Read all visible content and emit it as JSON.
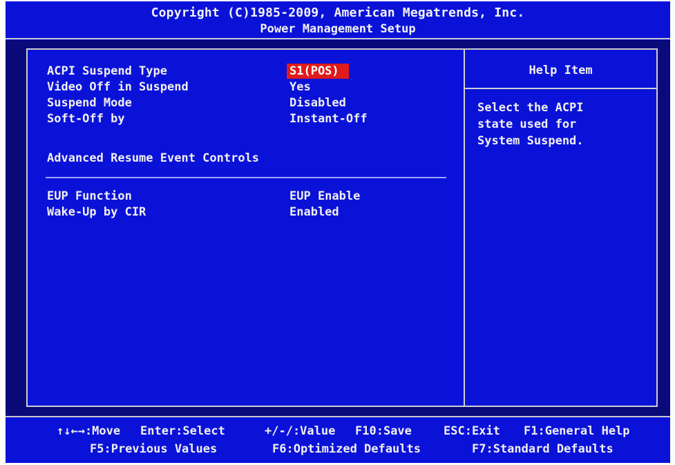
{
  "header": {
    "copyright": "Copyright (C)1985-2009, American Megatrends, Inc.",
    "title": "Power Management Setup"
  },
  "settings": [
    {
      "label": "ACPI Suspend Type",
      "value": "S1(POS)"
    },
    {
      "label": "Video Off in Suspend",
      "value": "Yes"
    },
    {
      "label": "Suspend Mode",
      "value": "Disabled"
    },
    {
      "label": "Soft-Off by",
      "value": "Instant-Off"
    }
  ],
  "section": {
    "heading": "Advanced Resume Event Controls"
  },
  "settings2": [
    {
      "label": "EUP Function",
      "value": "EUP Enable"
    },
    {
      "label": "Wake-Up by CIR",
      "value": "Enabled"
    }
  ],
  "help": {
    "title": "Help Item",
    "lines": [
      "Select the ACPI",
      "state used for",
      "System Suspend."
    ]
  },
  "footer": {
    "row1": {
      "move": "↑↓←→:Move",
      "select": "Enter:Select",
      "value": "+/-/:Value",
      "save": "F10:Save",
      "exit": "ESC:Exit",
      "general_help": "F1:General Help"
    },
    "row2": {
      "previous": "F5:Previous Values",
      "optimized": "F6:Optimized Defaults",
      "standard": "F7:Standard Defaults"
    }
  },
  "colors": {
    "background": "#0a0a7a",
    "panel": "#0b12d8",
    "highlight": "#e01b1b",
    "text": "#f0f0f0"
  }
}
